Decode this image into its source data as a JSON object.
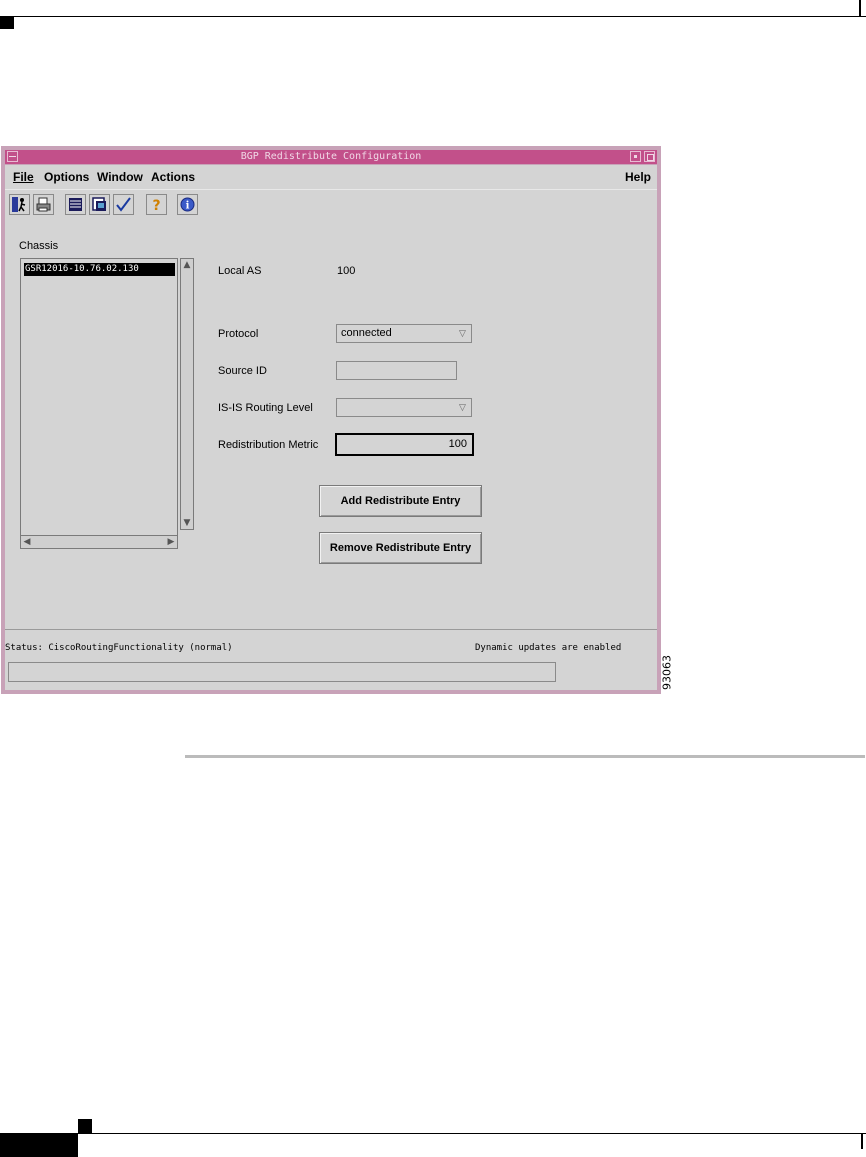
{
  "window": {
    "title": "BGP Redistribute Configuration"
  },
  "menubar": {
    "file": "File",
    "options": "Options",
    "window": "Window",
    "actions": "Actions",
    "help": "Help"
  },
  "toolbar": {
    "icons": [
      "exit-icon",
      "print-icon",
      "list-icon",
      "properties-icon",
      "apply-check-icon",
      "help-icon",
      "info-icon"
    ]
  },
  "chassis": {
    "label": "Chassis",
    "items": [
      "GSR12016-10.76.02.130"
    ]
  },
  "form": {
    "local_as_label": "Local AS",
    "local_as_value": "100",
    "protocol_label": "Protocol",
    "protocol_value": "connected",
    "source_id_label": "Source ID",
    "source_id_value": "",
    "isis_level_label": "IS-IS Routing Level",
    "isis_level_value": "",
    "metric_label": "Redistribution Metric",
    "metric_value": "100"
  },
  "actions": {
    "add_label": "Add Redistribute Entry",
    "remove_label": "Remove Redistribute Entry"
  },
  "status": {
    "text": "Status: CiscoRoutingFunctionality (normal)",
    "updates": "Dynamic updates are enabled"
  },
  "figure_number": "93063",
  "colors": {
    "title_bar": "#c2508a",
    "window_frame": "#c8a2b8",
    "client_bg": "#d4d4d4",
    "selection": "#000000"
  }
}
